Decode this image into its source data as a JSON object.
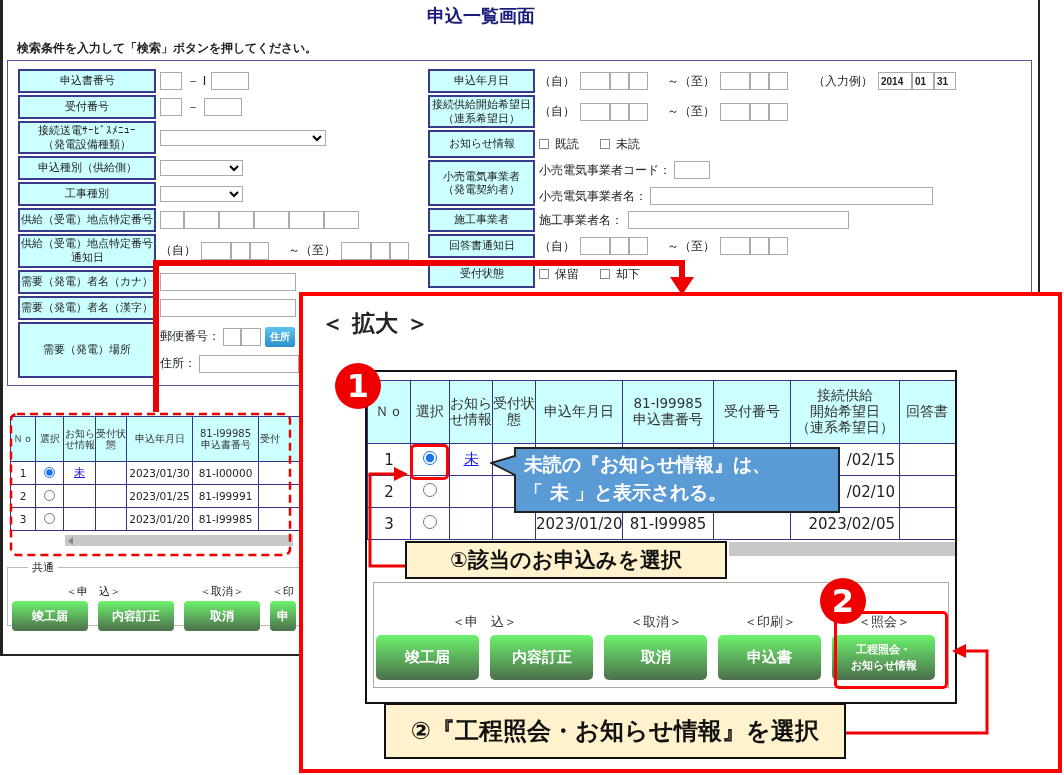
{
  "page": {
    "title": "申込一覧画面",
    "instruction": "検索条件を入力して「検索」ボタンを押してください。"
  },
  "search_form": {
    "left_rows": [
      {
        "label": [
          "申込書番号"
        ],
        "kind": "code_pair",
        "separator": "－ I"
      },
      {
        "label": [
          "受付番号"
        ],
        "kind": "code_pair",
        "separator": "－"
      },
      {
        "label": [
          "接続送電ｻｰﾋﾞｽﾒﾆｭｰ",
          "（発電設備種類）"
        ],
        "kind": "wide_select"
      },
      {
        "label": [
          "申込種別（供給側）"
        ],
        "kind": "select"
      },
      {
        "label": [
          "工事種別"
        ],
        "kind": "select"
      },
      {
        "label": [
          "供給（受電）地点特定番号"
        ],
        "kind": "segments"
      },
      {
        "label": [
          "供給（受電）地点特定番号",
          "通知日"
        ],
        "kind": "date_range",
        "from": "（自）",
        "to": "～（至）"
      },
      {
        "label": [
          "需要（発電）者名（カナ）"
        ],
        "kind": "text"
      },
      {
        "label": [
          "需要（発電）者名（漢字）"
        ],
        "kind": "text"
      },
      {
        "label": [
          "需要（発電）場所"
        ],
        "kind": "address",
        "postal_label": "郵便番号：",
        "button": "住所",
        "address_label": "住所："
      }
    ],
    "right_rows": [
      {
        "label": [
          "申込年月日"
        ],
        "kind": "date_range",
        "from": "（自）",
        "to": "～（至）",
        "example": {
          "label": "（入力例）",
          "values": [
            "2014",
            "01",
            "31"
          ]
        }
      },
      {
        "label": [
          "接続供給開始希望日",
          "（連系希望日）"
        ],
        "kind": "date_range",
        "from": "（自）",
        "to": "～（至）"
      },
      {
        "label": [
          "お知らせ情報"
        ],
        "kind": "checks",
        "options": [
          {
            "label": "既読",
            "checked": false
          },
          {
            "label": "未読",
            "checked": false
          }
        ]
      },
      {
        "label": [
          "小売電気事業者",
          "（発電契約者）"
        ],
        "kind": "retailer",
        "code_label": "小売電気事業者コード：",
        "name_label": "小売電気事業者名："
      },
      {
        "label": [
          "施工事業者"
        ],
        "kind": "contractor",
        "name_label": "施工事業者名："
      },
      {
        "label": [
          "回答書通知日"
        ],
        "kind": "date_range",
        "from": "（自）",
        "to": "～（至）"
      },
      {
        "label": [
          "受付状態"
        ],
        "kind": "checks",
        "options": [
          {
            "label": "保留",
            "checked": false
          },
          {
            "label": "却下",
            "checked": false
          }
        ]
      }
    ]
  },
  "results_table": {
    "columns": [
      [
        "Ｎｏ"
      ],
      [
        "選択"
      ],
      [
        "お知らせ情報"
      ],
      [
        "受付状態"
      ],
      [
        "申込年月日"
      ],
      [
        "81-I99985",
        "申込書番号"
      ],
      [
        "受付"
      ]
    ],
    "rows": [
      {
        "no": "1",
        "selected": true,
        "notice": "未",
        "date": "2023/01/30",
        "app_no": "81-I00000"
      },
      {
        "no": "2",
        "selected": false,
        "date": "2023/01/25",
        "app_no": "81-I99991"
      },
      {
        "no": "3",
        "selected": false,
        "date": "2023/01/20",
        "app_no": "81-I99985"
      }
    ]
  },
  "common_panel": {
    "legend": "共通",
    "groups": [
      {
        "caption": "＜申　込＞",
        "buttons": [
          "竣工届",
          "内容訂正"
        ]
      },
      {
        "caption": "＜取消＞",
        "buttons": [
          "取消"
        ]
      },
      {
        "caption": "＜印",
        "buttons": [
          "申"
        ]
      }
    ]
  },
  "zoom_panel": {
    "heading": "＜ 拡大 ＞",
    "table": {
      "columns": [
        [
          "Ｎｏ"
        ],
        [
          "選択"
        ],
        [
          "お知らせ情報"
        ],
        [
          "受付状態"
        ],
        [
          "申込年月日"
        ],
        [
          "81-I99985",
          "申込書番号"
        ],
        [
          "受付番号"
        ],
        [
          "接続供給",
          "開始希望日",
          "（連系希望日）"
        ],
        [
          "回答書"
        ]
      ],
      "rows": [
        {
          "no": "1",
          "selected": true,
          "notice": "未",
          "start": "/02/15"
        },
        {
          "no": "2",
          "selected": false,
          "start": "/02/10"
        },
        {
          "no": "3",
          "selected": false,
          "date": "2023/01/20",
          "app_no": "81-I99985",
          "start": "2023/02/05"
        }
      ]
    },
    "groups": [
      {
        "caption": "＜申　込＞",
        "buttons": [
          [
            "竣工届"
          ],
          [
            "内容訂正"
          ]
        ]
      },
      {
        "caption": "＜取消＞",
        "buttons": [
          [
            "取消"
          ]
        ]
      },
      {
        "caption": "＜印刷＞",
        "buttons": [
          [
            "申込書"
          ]
        ]
      },
      {
        "caption": "＜照会＞",
        "buttons": [
          [
            "工程照会・",
            "お知らせ情報"
          ]
        ]
      }
    ]
  },
  "annotations": {
    "step_badges": [
      "1",
      "2"
    ],
    "callout": [
      "未読の『お知らせ情報』は、",
      "「 未 」と表示される。"
    ],
    "step_labels": [
      "①該当のお申込みを選択",
      "②『工程照会・お知らせ情報』を選択"
    ]
  }
}
